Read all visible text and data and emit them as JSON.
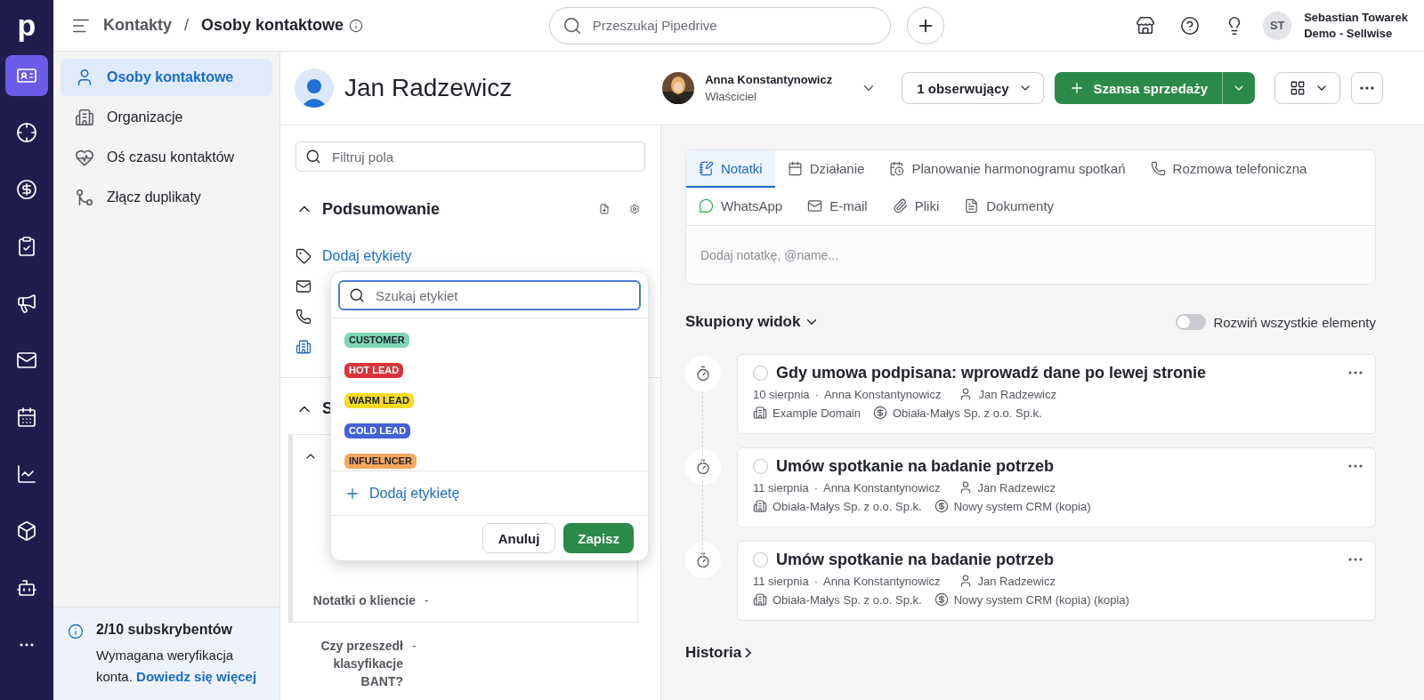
{
  "rail": {
    "logo": "p",
    "items": [
      {
        "kind": "contacts",
        "selected": true
      },
      {
        "kind": "leads",
        "selected": false
      },
      {
        "kind": "deals",
        "selected": false
      },
      {
        "kind": "tasks",
        "selected": false
      },
      {
        "kind": "campaigns",
        "selected": false
      },
      {
        "kind": "mail",
        "selected": false
      },
      {
        "kind": "calendar",
        "selected": false
      },
      {
        "kind": "insights",
        "selected": false
      },
      {
        "kind": "products",
        "selected": false
      },
      {
        "kind": "assistant",
        "selected": false
      },
      {
        "kind": "more",
        "selected": false
      }
    ]
  },
  "topbar": {
    "breadcrumb_parent": "Kontakty",
    "breadcrumb_separator": "/",
    "breadcrumb_current": "Osoby kontaktowe",
    "search_placeholder": "Przeszukaj Pipedrive",
    "user_initials": "ST",
    "user_name": "Sebastian Towarek",
    "user_company": "Demo - Sellwise"
  },
  "sidebar": {
    "items": [
      {
        "label": "Osoby kontaktowe",
        "kind": "person",
        "selected": true
      },
      {
        "label": "Organizacje",
        "kind": "building",
        "selected": false
      },
      {
        "label": "Oś czasu kontaktów",
        "kind": "heart",
        "selected": false
      },
      {
        "label": "Złącz duplikaty",
        "kind": "merge",
        "selected": false
      }
    ],
    "notice": {
      "title": "2/10 subskrybentów",
      "text": "Wymagana weryfikacja konta.",
      "link": "Dowiedz się więcej"
    }
  },
  "person": {
    "name": "Jan Radzewicz",
    "owner_name": "Anna Konstantynowicz",
    "owner_role": "Właściciel",
    "followers": "1 obserwujący",
    "deal_button": "Szansa sprzedaży"
  },
  "details": {
    "filter_placeholder": "Filtruj pola",
    "summary_title": "Podsumowanie",
    "add_labels": "Dodaj etykiety",
    "summary_rows": [
      {
        "kind": "mail"
      },
      {
        "kind": "phone"
      },
      {
        "kind": "organization"
      }
    ],
    "section_title": "S",
    "card_fields": [
      {
        "label": "Notatki o kliencie",
        "value": "-"
      }
    ],
    "fields": [
      {
        "label": "Czy przeszedł klasyfikacje BANT?",
        "value": "-"
      }
    ],
    "label_picker": {
      "search_placeholder": "Szukaj etykiet",
      "labels": [
        {
          "text": "CUSTOMER",
          "color": "#7ed7b4"
        },
        {
          "text": "HOT LEAD",
          "color": "#d8343a"
        },
        {
          "text": "WARM LEAD",
          "color": "#f6dc25"
        },
        {
          "text": "COLD LEAD",
          "color": "#4561d6"
        },
        {
          "text": "INFUELNCER",
          "color": "#f8a85c"
        }
      ],
      "add_label": "Dodaj etykietę",
      "cancel": "Anuluj",
      "save": "Zapisz"
    }
  },
  "composer": {
    "tabs": [
      {
        "label": "Notatki",
        "kind": "note",
        "selected": true
      },
      {
        "label": "Działanie",
        "kind": "calendar",
        "selected": false
      },
      {
        "label": "Planowanie harmonogramu spotkań",
        "kind": "schedule",
        "selected": false
      },
      {
        "label": "Rozmowa telefoniczna",
        "kind": "phone",
        "selected": false
      },
      {
        "label": "WhatsApp",
        "kind": "whatsapp",
        "selected": false
      },
      {
        "label": "E-mail",
        "kind": "mail",
        "selected": false
      },
      {
        "label": "Pliki",
        "kind": "clip",
        "selected": false
      },
      {
        "label": "Dokumenty",
        "kind": "doc",
        "selected": false
      }
    ],
    "placeholder": "Dodaj notatkę, @name..."
  },
  "focus": {
    "title": "Skupiony widok",
    "expand_all_label": "Rozwiń wszystkie elementy",
    "expand_all_on": false
  },
  "activities": [
    {
      "title": "Gdy umowa podpisana: wprowadź dane po lewej stronie",
      "date": "10 sierpnia",
      "separator": "·",
      "owner": "Anna Konstantynowicz",
      "person": "Jan Radzewicz",
      "organization": "Example Domain",
      "deal": "Obiała-Małys Sp. z o.o. Sp.k.",
      "done": false
    },
    {
      "title": "Umów spotkanie na badanie potrzeb",
      "date": "11 sierpnia",
      "separator": "·",
      "owner": "Anna Konstantynowicz",
      "person": "Jan Radzewicz",
      "organization": "Obiała-Małys Sp. z o.o. Sp.k.",
      "deal": "Nowy system CRM (kopia)",
      "done": false
    },
    {
      "title": "Umów spotkanie na badanie potrzeb",
      "date": "11 sierpnia",
      "separator": "·",
      "owner": "Anna Konstantynowicz",
      "person": "Jan Radzewicz",
      "organization": "Obiała-Małys Sp. z o.o. Sp.k.",
      "deal": "Nowy system CRM (kopia) (kopia)",
      "done": false
    }
  ],
  "history_title": "Historia"
}
